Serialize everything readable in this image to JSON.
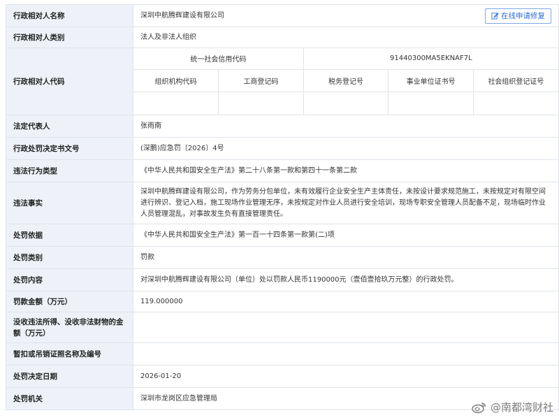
{
  "rows": {
    "name": {
      "label": "行政相对人名称",
      "value": "深圳中航腾辉建设有限公司",
      "action": "在线申请修复"
    },
    "type": {
      "label": "行政相对人类别",
      "value": "法人及非法人组织"
    },
    "code": {
      "label": "行政相对人代码",
      "credit_code_label": "统一社会信用代码",
      "credit_code_value": "91440300MA5EKNAF7L",
      "sub_headers": [
        "组织机构代码",
        "工商登记码",
        "税务登记号",
        "事业单位证书号",
        "社会组织登记证号"
      ],
      "sub_values": [
        "",
        "",
        "",
        "",
        ""
      ]
    },
    "legal_rep": {
      "label": "法定代表人",
      "value": "张雨南"
    },
    "doc_no": {
      "label": "行政处罚决定书文号",
      "value": "(深鹏)应急罚〔2026〕4号"
    },
    "violation_type": {
      "label": "违法行为类型",
      "value": "《中华人民共和国安全生产法》第二十八条第一款和第四十一条第二款"
    },
    "facts": {
      "label": "违法事实",
      "value": "深圳中航腾辉建设有限公司，作为劳务分包单位，未有效履行企业安全生产主体责任，未按设计要求规范施工，未按规定对有限空间进行辨识、登记入档，施工现场作业管理无序，未按规定对作业人员进行安全培训，现场专职安全管理人员配备不足，现场临时作业人员管理混乱，对事故发生负有直接管理责任。"
    },
    "basis": {
      "label": "处罚依据",
      "value": "《中华人民共和国安全生产法》第一百一十四条第一款第(二)项"
    },
    "category": {
      "label": "处罚类别",
      "value": "罚款"
    },
    "content": {
      "label": "处罚内容",
      "value": "对深圳中航腾辉建设有限公司（单位）处以罚款人民币1190000元（壹佰壹拾玖万元整）的行政处罚。"
    },
    "fine": {
      "label": "罚款金额（万元）",
      "value": "119.000000"
    },
    "confiscation": {
      "label": "没收违法所得、没收非法财物的金额（万元）",
      "value": ""
    },
    "license": {
      "label": "暂扣或吊销证照名称及编号",
      "value": ""
    },
    "date": {
      "label": "处罚决定日期",
      "value": "2026-01-20"
    },
    "authority": {
      "label": "处罚机关",
      "value": "深圳市龙岗区应急管理局"
    }
  },
  "watermark": {
    "text": "@南都湾财社",
    "icon": "weibo-icon"
  }
}
